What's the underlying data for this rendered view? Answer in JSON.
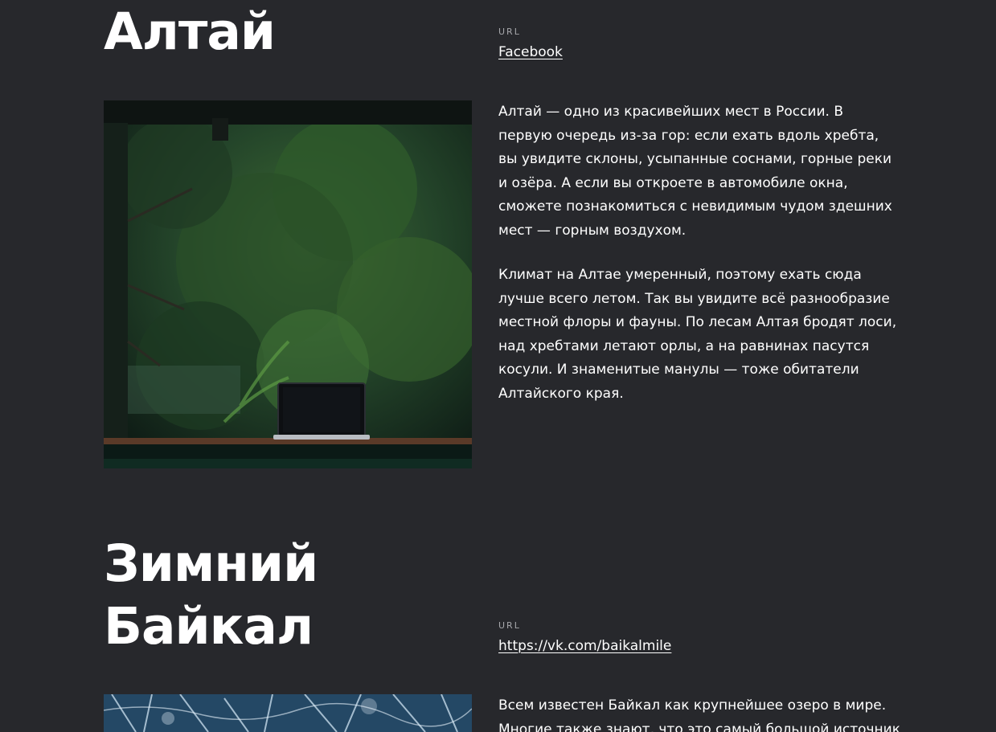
{
  "articles": [
    {
      "title": "Алтай",
      "url_label": "URL",
      "url_text": "Facebook",
      "photo_icon": "forest-laptop-photo",
      "paragraphs": [
        "Алтай — одно из красивейших мест в России. В первую очередь из-за гор: если ехать вдоль хребта, вы увидите склоны, усыпанные соснами, горные реки и озёра. А если вы откроете в автомобиле окна, сможете познакомиться с невидимым чудом здешних мест — горным воздухом.",
        "Климат на Алтае умеренный, поэтому ехать сюда лучше всего летом. Так вы увидите всё разнообразие местной флоры и фауны. По лесам Алтая бродят лоси, над хребтами летают орлы, а на равнинах пасутся косули. И знаменитые манулы — тоже обитатели Алтайского края."
      ]
    },
    {
      "title_line1": "Зимний",
      "title_line2": "Байкал",
      "url_label": "URL",
      "url_text": "https://vk.com/baikalmile",
      "photo_icon": "frozen-lake-ice-photo",
      "paragraphs": [
        "Всем известен Байкал как крупнейшее озеро в мире.",
        "Многие также знают, что это самый большой источник"
      ]
    }
  ],
  "colors": {
    "background": "#27282c",
    "text": "#ffffff",
    "label": "#a6a7ab"
  }
}
